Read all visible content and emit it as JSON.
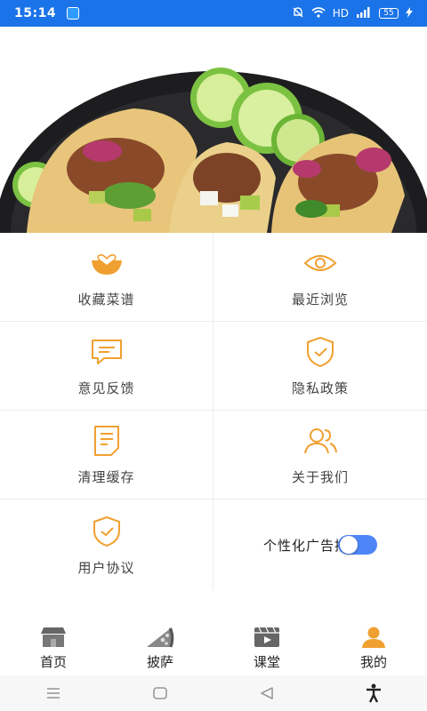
{
  "status_bar": {
    "time": "15:14",
    "network": "HD",
    "battery": "55",
    "signal": "4G"
  },
  "menu": [
    {
      "label": "收藏菜谱",
      "icon": "heart-bowl-icon"
    },
    {
      "label": "最近浏览",
      "icon": "eye-icon"
    },
    {
      "label": "意见反馈",
      "icon": "feedback-icon"
    },
    {
      "label": "隐私政策",
      "icon": "shield-check-icon"
    },
    {
      "label": "清理缓存",
      "icon": "document-icon"
    },
    {
      "label": "关于我们",
      "icon": "users-icon"
    },
    {
      "label": "用户协议",
      "icon": "shield-check-icon"
    }
  ],
  "ad_toggle": {
    "label": "个性化广告推荐",
    "enabled": true
  },
  "tabs": [
    {
      "label": "首页",
      "icon": "store-icon"
    },
    {
      "label": "披萨",
      "icon": "pizza-icon"
    },
    {
      "label": "课堂",
      "icon": "video-icon"
    },
    {
      "label": "我的",
      "icon": "user-icon"
    }
  ],
  "colors": {
    "accent": "#f0a030",
    "status_bar": "#1a73e8",
    "toggle": "#4f86f7"
  }
}
